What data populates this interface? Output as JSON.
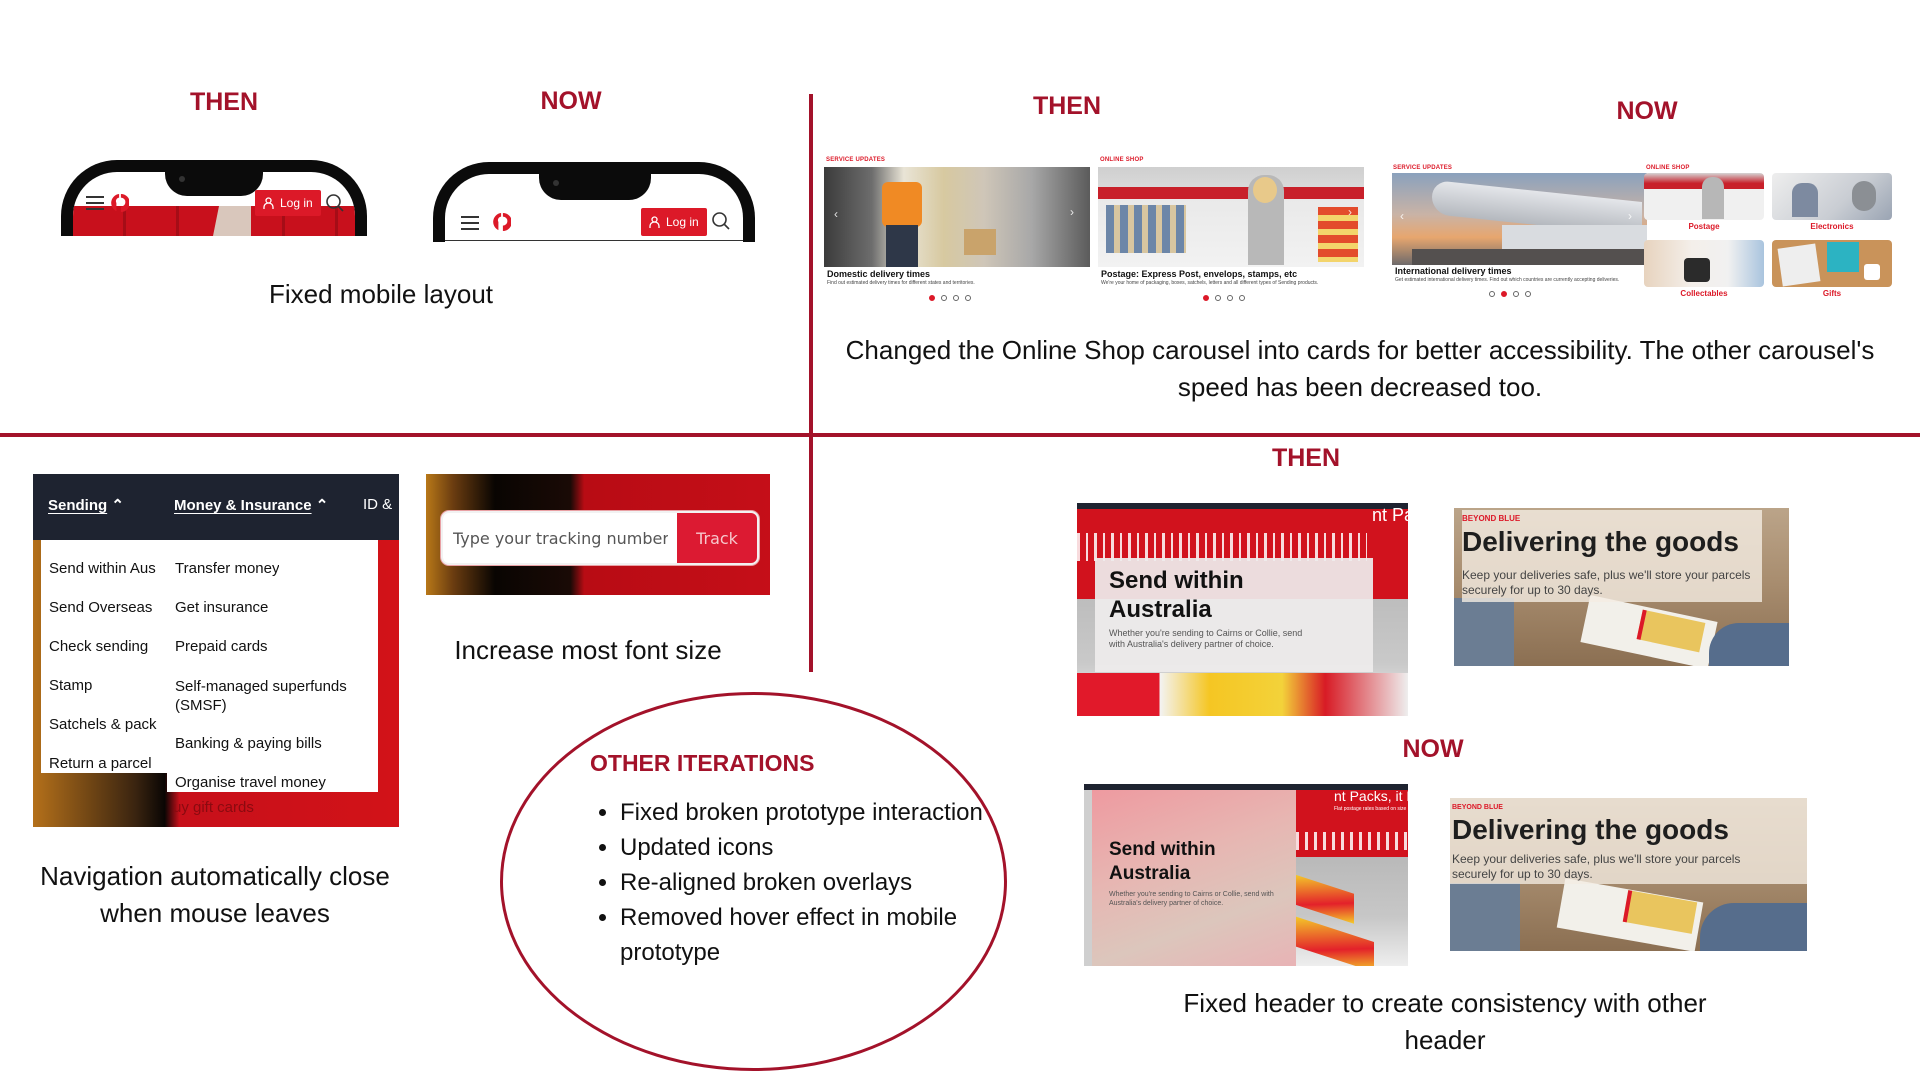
{
  "quadrants": {
    "mobile": {
      "then_label": "THEN",
      "now_label": "NOW",
      "caption": "Fixed mobile layout",
      "phone": {
        "login_label": "Log in",
        "icons": [
          "hamburger-menu-icon",
          "auspost-logo-icon",
          "user-icon",
          "search-icon"
        ]
      }
    },
    "carousel": {
      "then_label": "THEN",
      "now_label": "NOW",
      "caption": "Changed the Online Shop carousel into cards for better accessibility. The other carousel's speed has been decreased too.",
      "then": {
        "service_updates": {
          "section_label": "SERVICE UPDATES",
          "title": "Domestic delivery times",
          "description": "Find out estimated delivery times for different states and territories.",
          "dots_total": 4,
          "active_dot": 1
        },
        "online_shop": {
          "section_label": "ONLINE SHOP",
          "title": "Postage: Express Post, envelops, stamps, etc",
          "description": "We're your home of packaging, boxes, satchels, letters and all different types of Sending products.",
          "dots_total": 4,
          "active_dot": 1
        }
      },
      "now": {
        "service_updates": {
          "section_label": "SERVICE UPDATES",
          "title": "International delivery times",
          "description": "Get estimated international delivery times. Find out which countries are currently accepting deliveries.",
          "dots_total": 4,
          "active_dot": 2
        },
        "online_shop": {
          "section_label": "ONLINE SHOP",
          "cards": [
            "Postage",
            "Electronics",
            "Collectables",
            "Gifts"
          ]
        }
      }
    },
    "navigation": {
      "top_items": [
        "Sending",
        "Money & Insurance",
        "ID &"
      ],
      "sending_items": [
        "Send within Aus",
        "Send Overseas",
        "Check sending",
        "Stamp",
        "Satchels & pack",
        "Return a parcel"
      ],
      "money_items": [
        "Transfer money",
        "Get insurance",
        "Prepaid cards",
        "Self-managed superfunds (SMSF)",
        "Banking & paying bills",
        "Organise travel money"
      ],
      "behind_text": "uy gift cards",
      "caption": "Navigation automatically close when mouse leaves"
    },
    "tracking": {
      "placeholder": "Type your tracking number",
      "button_label": "Track",
      "caption": "Increase most font size"
    },
    "other_iterations": {
      "title": "OTHER ITERATIONS",
      "items": [
        "Fixed broken prototype interaction",
        "Updated icons",
        "Re-aligned broken overlays",
        "Removed hover effect in mobile prototype"
      ]
    },
    "header": {
      "then_label": "THEN",
      "now_label": "NOW",
      "caption": "Fixed header to create consistency with other header",
      "send_card": {
        "title": "Send within Australia",
        "description": "Whether you're sending to Cairns or Collie, send with Australia's delivery partner of choice.",
        "bg_text_then": "nt Pa",
        "bg_text_now": "nt Packs, it P",
        "bg_subtext": "Flat postage rates based on size"
      },
      "delivering_card": {
        "label": "BEYOND BLUE",
        "title": "Delivering the goods",
        "description": "Keep your deliveries safe, plus we'll store your parcels securely for up to 30 days."
      }
    }
  },
  "colors": {
    "accent": "#a3122a",
    "brand_red": "#dc1928",
    "nav_dark": "#1e2330"
  }
}
